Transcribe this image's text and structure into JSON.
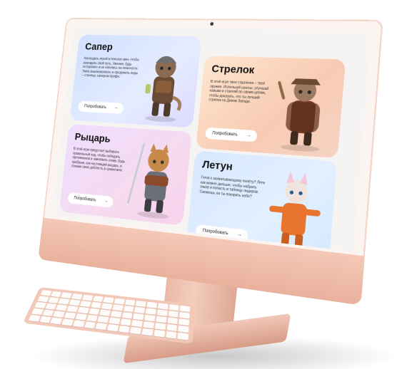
{
  "cards": [
    {
      "title": "Сапер",
      "description": "Насладись игрой в поисках мин, чтобы разгадать свой путь, Умения, будь осторожен и не наткнись на опасности. Умея анализировать и продумать ходы – станешь сапером-профи.",
      "button": "Попробовать",
      "arrow": "→",
      "cat_icon": "sapper-cat-icon"
    },
    {
      "title": "Стрелок",
      "description": "В этой игре твоя стратегия – твоё оружие. Используй шансы, улучшай навыки и стреляй по своим целям, чтобы доказать, что ты лучший стрелок на Диком Западе.",
      "button": "Попробовать",
      "arrow": "→",
      "cat_icon": "gunslinger-cat-icon"
    },
    {
      "title": "Рыцарь",
      "description": "В этой игре предстоит выбирать правильный ход, чтобы победить противников и завоевать славу. Будь храбрым, как настоящий рыцарь, и покажи свою доблесть в сражениях.",
      "button": "Попробовать",
      "arrow": "→",
      "cat_icon": "knight-cat-icon"
    },
    {
      "title": "Летун",
      "description": "Готов к захватывающему полёту? Лети как можно дальше, чтобы набрать очков и попасть в таблицу лидеров. Сможешь ли ты покорить небо?",
      "button": "Попробовать",
      "arrow": "→",
      "cat_icon": "pilot-cat-icon"
    }
  ]
}
